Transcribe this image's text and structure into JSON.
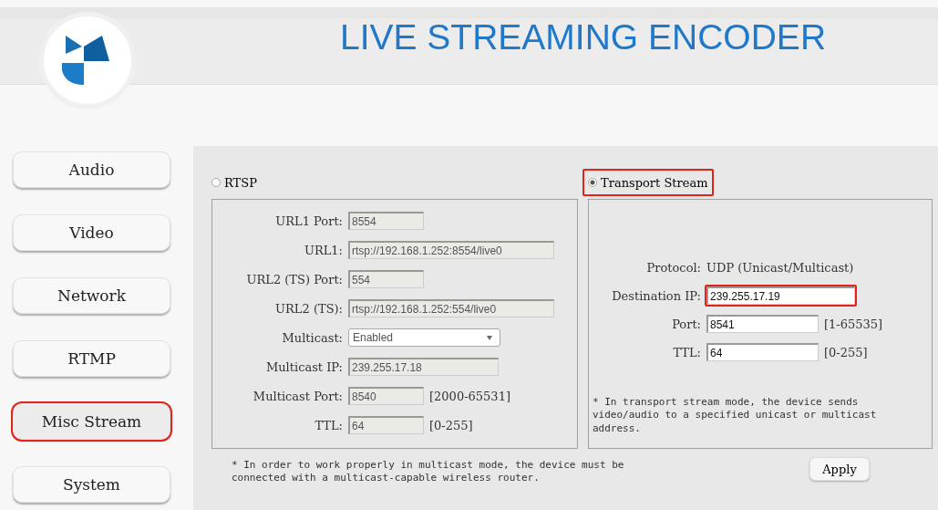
{
  "header": {
    "title": "LIVE STREAMING ENCODER"
  },
  "sidebar": {
    "items": [
      {
        "label": "Audio",
        "selected": false
      },
      {
        "label": "Video",
        "selected": false
      },
      {
        "label": "Network",
        "selected": false
      },
      {
        "label": "RTMP",
        "selected": false
      },
      {
        "label": "Misc Stream",
        "selected": true
      },
      {
        "label": "System",
        "selected": false
      }
    ]
  },
  "rtsp": {
    "label": "RTSP",
    "selected": false,
    "highlighted": false,
    "fields": [
      {
        "kind": "input",
        "label": "URL1 Port:",
        "value": "8554"
      },
      {
        "kind": "input",
        "label": "URL1:",
        "value": "rtsp://192.168.1.252:8554/live0"
      },
      {
        "kind": "input",
        "label": "URL2 (TS) Port:",
        "value": "554"
      },
      {
        "kind": "input",
        "label": "URL2 (TS):",
        "value": "rtsp://192.168.1.252:554/live0"
      },
      {
        "kind": "select",
        "label": "Multicast:",
        "value": "Enabled"
      },
      {
        "kind": "input",
        "label": "Multicast IP:",
        "value": "239.255.17.18"
      },
      {
        "kind": "input",
        "label": "Multicast Port:",
        "value": "8540",
        "range": "[2000-65531]"
      },
      {
        "kind": "input",
        "label": "TTL:",
        "value": "64",
        "range": "[0-255]"
      }
    ]
  },
  "transport_stream": {
    "label": "Transport Stream",
    "selected": true,
    "highlighted": true,
    "fields": [
      {
        "kind": "text",
        "label": "Protocol:",
        "value": "UDP (Unicast/Multicast)"
      },
      {
        "kind": "input",
        "label": "Destination IP:",
        "value": "239.255.17.19",
        "highlighted": true
      },
      {
        "kind": "input",
        "label": "Port:",
        "value": "8541",
        "range": "[1-65535]",
        "highlighted": false
      },
      {
        "kind": "input",
        "label": "TTL:",
        "value": "64",
        "range": "[0-255]",
        "highlighted": false
      }
    ],
    "note": "* In transport stream mode, the device sends video/audio to a specified unicast or multicast address."
  },
  "footer_note": "* In order to work properly in multicast mode, the device must be connected with a multicast-capable wireless router.",
  "apply_button": "Apply"
}
